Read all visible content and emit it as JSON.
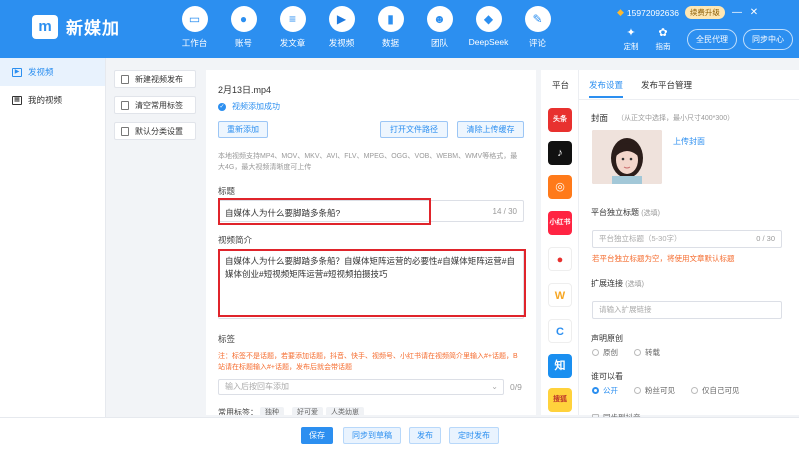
{
  "app": {
    "name": "新媒加",
    "logo_mark": "m"
  },
  "nav": [
    {
      "label": "工作台",
      "icon": "desktop-icon",
      "glyph": "▭"
    },
    {
      "label": "账号",
      "icon": "user-icon",
      "glyph": "●"
    },
    {
      "label": "发文章",
      "icon": "document-icon",
      "glyph": "≡"
    },
    {
      "label": "发视频",
      "icon": "video-camera-icon",
      "glyph": "▶",
      "active": true
    },
    {
      "label": "数据",
      "icon": "bar-chart-icon",
      "glyph": "▮"
    },
    {
      "label": "团队",
      "icon": "team-icon",
      "glyph": "☻"
    },
    {
      "label": "DeepSeek",
      "icon": "deepseek-whale-icon",
      "glyph": "◆"
    },
    {
      "label": "评论",
      "icon": "comment-icon",
      "glyph": "✎"
    }
  ],
  "user": {
    "phone": "15972092636",
    "upgrade": "续费升级"
  },
  "window": {
    "minimize": "—",
    "close": "✕"
  },
  "tools": [
    {
      "label": "定制",
      "glyph": "✦"
    },
    {
      "label": "指南",
      "glyph": "✿"
    }
  ],
  "top_buttons": {
    "agent": "全民代理",
    "sync": "同步中心"
  },
  "sidebar": [
    {
      "label": "发视频",
      "active": true
    },
    {
      "label": "我的视频",
      "active": false
    }
  ],
  "actions": [
    "新建视频发布",
    "清空常用标签",
    "默认分类设置"
  ],
  "form": {
    "file_name": "2月13日.mp4",
    "success": "视频添加成功",
    "readd": "重新添加",
    "open_path": "打开文件路径",
    "clear_cache": "清除上传缓存",
    "hint": "本地视频支持MP4、MOV、MKV、AVI、FLV、MPEG、OGG、VOB、WEBM、WMV等格式，最大4G，最大视频清晰度可上传",
    "title_label": "标题",
    "title_value": "自媒体人为什么要脚踏多条船?",
    "title_count": "14 / 30",
    "desc_label": "视频简介",
    "desc_value": "自媒体人为什么要脚踏多条船？自媒体矩阵运营的必要性#自媒体矩阵运营#自媒体创业#短视频矩阵运营#短视频拍摄技巧",
    "tags_label": "标签",
    "tags_warn": "注：标签不是话题，若要添加话题，抖音、快手、视频号、小红书请在视频简介里输入#+话题，B站请在标题输入#+话题，发布后就会带话题",
    "tags_placeholder": "输入后按回车添加",
    "tags_count": "0/9",
    "common_tags_label": "常用标签：",
    "common_tags": [
      "独种",
      "好可爱",
      "人类幼崽"
    ]
  },
  "platform": {
    "column_header": "平台",
    "platforms": [
      {
        "name": "头条",
        "icon": "toutiao-icon",
        "color": "#e8312f",
        "glyph": "头条"
      },
      {
        "name": "抖音",
        "icon": "douyin-icon",
        "color": "#111111",
        "glyph": "♪"
      },
      {
        "name": "快手",
        "icon": "kuaishou-icon",
        "color": "#ff7a1a",
        "glyph": "◎"
      },
      {
        "name": "小红书",
        "icon": "xiaohongshu-icon",
        "color": "#ff2442",
        "glyph": "小红书"
      },
      {
        "name": "西瓜视频",
        "icon": "xigua-icon",
        "color": "#ffffff",
        "glyph": "●"
      },
      {
        "name": "微视",
        "icon": "weishi-icon",
        "color": "#ffffff",
        "glyph": "W"
      },
      {
        "name": "百家号",
        "icon": "baijiahao-icon",
        "color": "#ffffff",
        "glyph": "C"
      },
      {
        "name": "知乎",
        "icon": "zhihu-icon",
        "color": "#1a8ff0",
        "glyph": "知"
      },
      {
        "name": "搜狐",
        "icon": "sohu-icon",
        "color": "#ffd23c",
        "glyph": "搜狐"
      }
    ],
    "tabs": [
      {
        "label": "发布设置",
        "active": true
      },
      {
        "label": "发布平台管理",
        "active": false
      }
    ],
    "cover_label": "封面",
    "cover_hint": "（从正文中选择，最小尺寸400*300）",
    "upload_cover": "上传封面",
    "independent_title_label": "平台独立标题",
    "optional": "(选填)",
    "independent_title_placeholder": "平台独立标题（5-30字）",
    "independent_title_count": "0 / 30",
    "warn": "若平台独立标题为空，将使用文章默认标题",
    "ext_link_label": "扩展连接",
    "ext_link_placeholder": "请输入扩展链接",
    "original_label": "声明原创",
    "original_options": [
      {
        "label": "原创",
        "checked": false
      },
      {
        "label": "转载",
        "checked": false
      }
    ],
    "visibility_label": "谁可以看",
    "visibility_options": [
      {
        "label": "公开",
        "checked": true
      },
      {
        "label": "粉丝可见",
        "checked": false
      },
      {
        "label": "仅自己可见",
        "checked": false
      }
    ],
    "partial_row": "同步到抖音"
  },
  "bottom": {
    "save": "保存",
    "sync_draft": "同步到草稿",
    "publish": "发布",
    "schedule": "定时发布"
  },
  "colors": {
    "brand": "#2c8ff0",
    "warn": "#f56c2f",
    "highlight": "#e0242b"
  }
}
